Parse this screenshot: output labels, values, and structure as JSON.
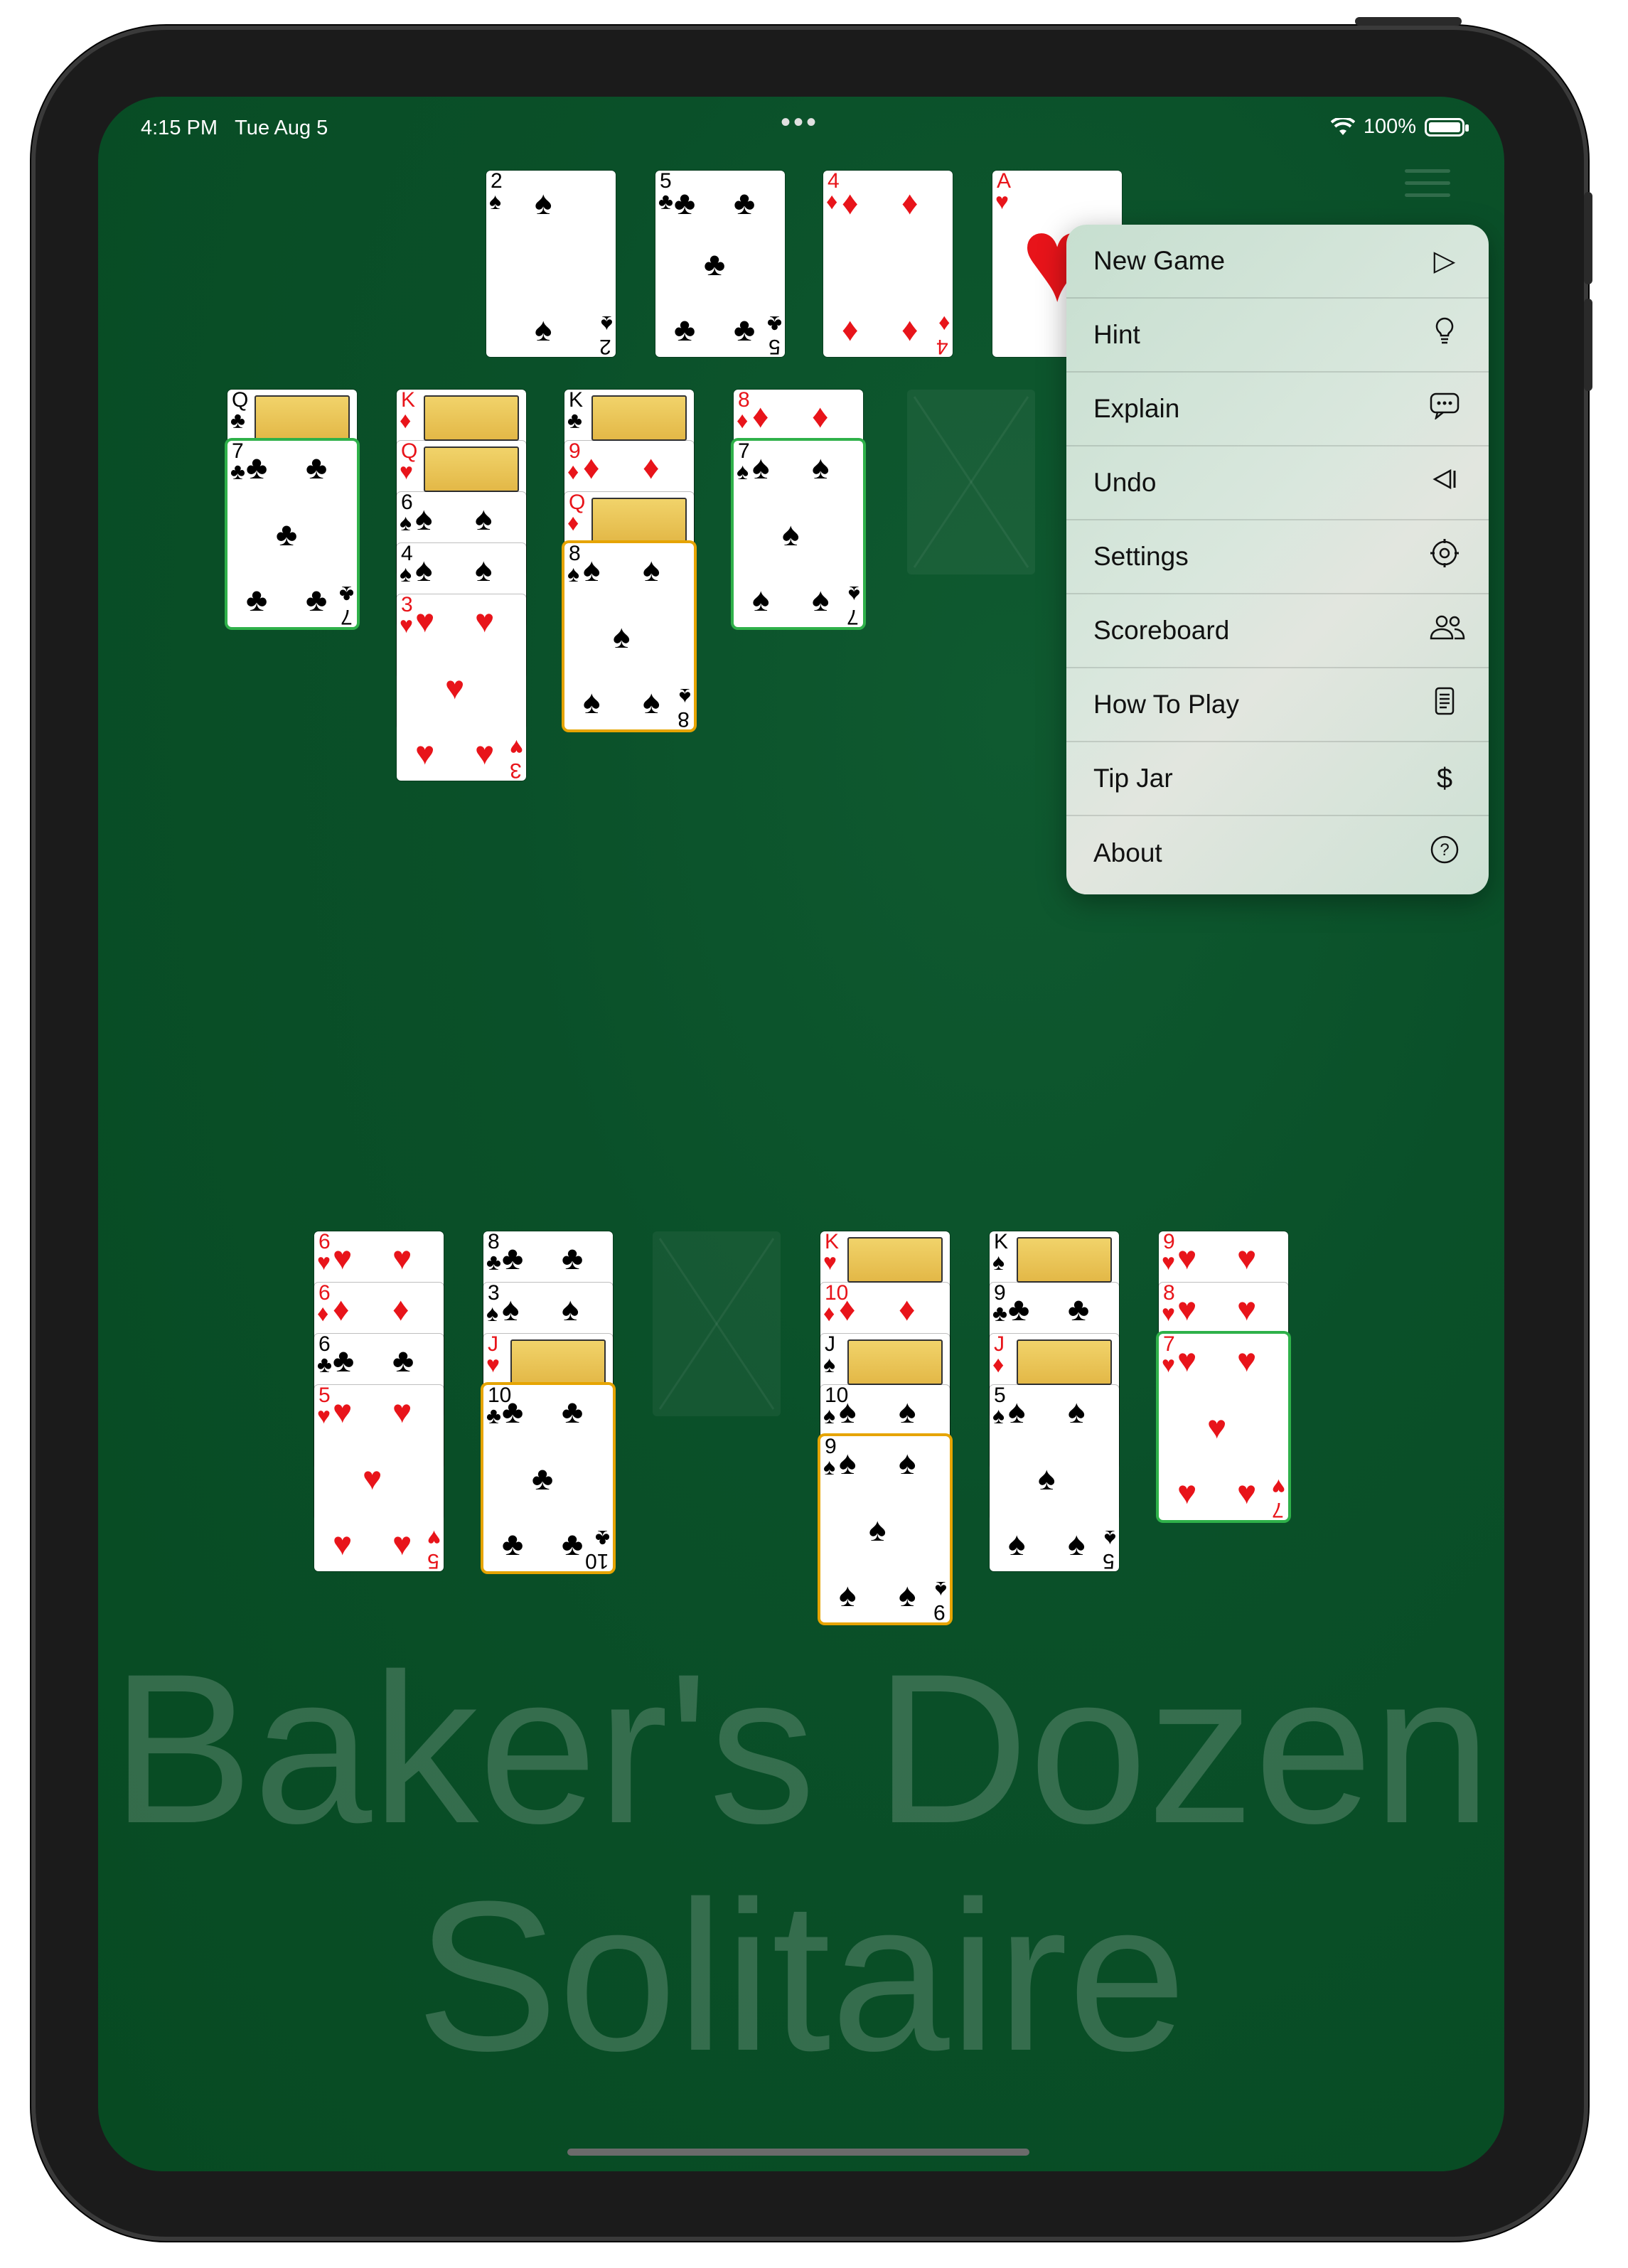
{
  "status_bar": {
    "time": "4:15 PM",
    "date": "Tue Aug 5",
    "battery": "100%"
  },
  "foundations": [
    {
      "rank": "2",
      "suit": "♠",
      "color": "black"
    },
    {
      "rank": "5",
      "suit": "♣",
      "color": "black"
    },
    {
      "rank": "4",
      "suit": "♦",
      "color": "red"
    },
    {
      "rank": "A",
      "suit": "♥",
      "color": "red"
    }
  ],
  "menu": {
    "items": [
      {
        "label": "New Game",
        "icon": "play-icon",
        "glyph": "▷"
      },
      {
        "label": "Hint",
        "icon": "lightbulb-icon",
        "glyph": "💡"
      },
      {
        "label": "Explain",
        "icon": "speech-bubble-icon",
        "glyph": "💬"
      },
      {
        "label": "Undo",
        "icon": "undo-icon",
        "glyph": "◁|"
      },
      {
        "label": "Settings",
        "icon": "gear-icon",
        "glyph": "⚙"
      },
      {
        "label": "Scoreboard",
        "icon": "people-icon",
        "glyph": "👥"
      },
      {
        "label": "How To Play",
        "icon": "document-icon",
        "glyph": "▤"
      },
      {
        "label": "Tip Jar",
        "icon": "dollar-icon",
        "glyph": "$"
      },
      {
        "label": "About",
        "icon": "question-icon",
        "glyph": "?"
      }
    ]
  },
  "tableau_top": [
    [
      "Q♣",
      "7♣"
    ],
    [
      "K♦",
      "Q♥",
      "6♠",
      "4♠",
      "3♥"
    ],
    [
      "K♣",
      "9♦",
      "Q♦",
      "8♠"
    ],
    [
      "8♦",
      "7♠"
    ],
    []
  ],
  "tableau_bottom": [
    [
      "6♥",
      "6♦",
      "6♣",
      "5♥"
    ],
    [
      "8♣",
      "3♠",
      "J♥",
      "10♣"
    ],
    [],
    [
      "K♥",
      "10♦",
      "J♠",
      "10♠",
      "9♠"
    ],
    [
      "K♠",
      "9♣",
      "J♦",
      "5♠"
    ],
    [
      "9♥",
      "8♥",
      "7♥"
    ]
  ],
  "watermark": {
    "line1": "Baker's Dozen",
    "line2": "Solitaire"
  }
}
